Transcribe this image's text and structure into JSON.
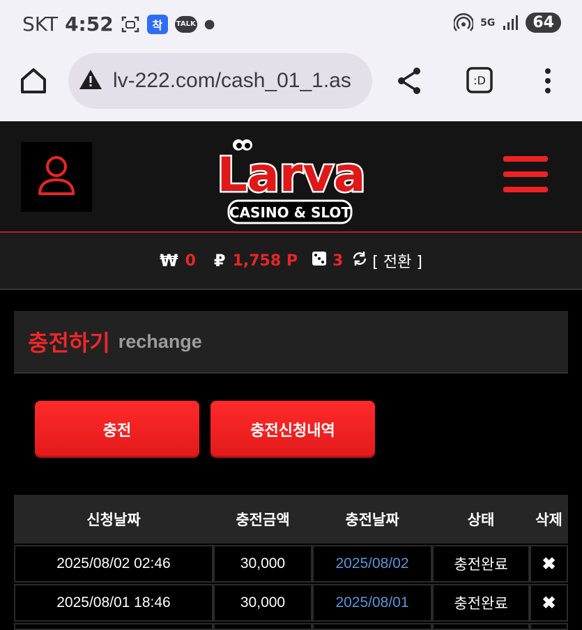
{
  "status_bar": {
    "carrier": "SKT",
    "time": "4:52",
    "talk_badge": "TALK",
    "blue_badge": "착",
    "network": "5G",
    "battery": "64"
  },
  "browser": {
    "url": "lv-222.com/cash_01_1.as"
  },
  "logo": {
    "brand": "Larva",
    "tagline": "CASINO & SLOT"
  },
  "balance": {
    "won_symbol": "₩",
    "won_value": "0",
    "point_symbol": "₽",
    "point_value": "1,758 P",
    "dice_value": "3",
    "switch_label": "[ 전환 ]"
  },
  "section": {
    "title_ko": "충전하기",
    "title_en": "rechange"
  },
  "buttons": {
    "charge": "충전",
    "history": "충전신청내역"
  },
  "table": {
    "headers": [
      "신청날짜",
      "충전금액",
      "충전날짜",
      "상태",
      "삭제"
    ],
    "rows": [
      {
        "requested": "2025/08/02 02:46",
        "amount": "30,000",
        "charged": "2025/08/02",
        "status": "충전완료",
        "delete": "✖"
      },
      {
        "requested": "2025/08/01 18:46",
        "amount": "30,000",
        "charged": "2025/08/01",
        "status": "충전완료",
        "delete": "✖"
      }
    ]
  },
  "colors": {
    "accent_red": "#e82626",
    "link_blue": "#5b95d6"
  }
}
